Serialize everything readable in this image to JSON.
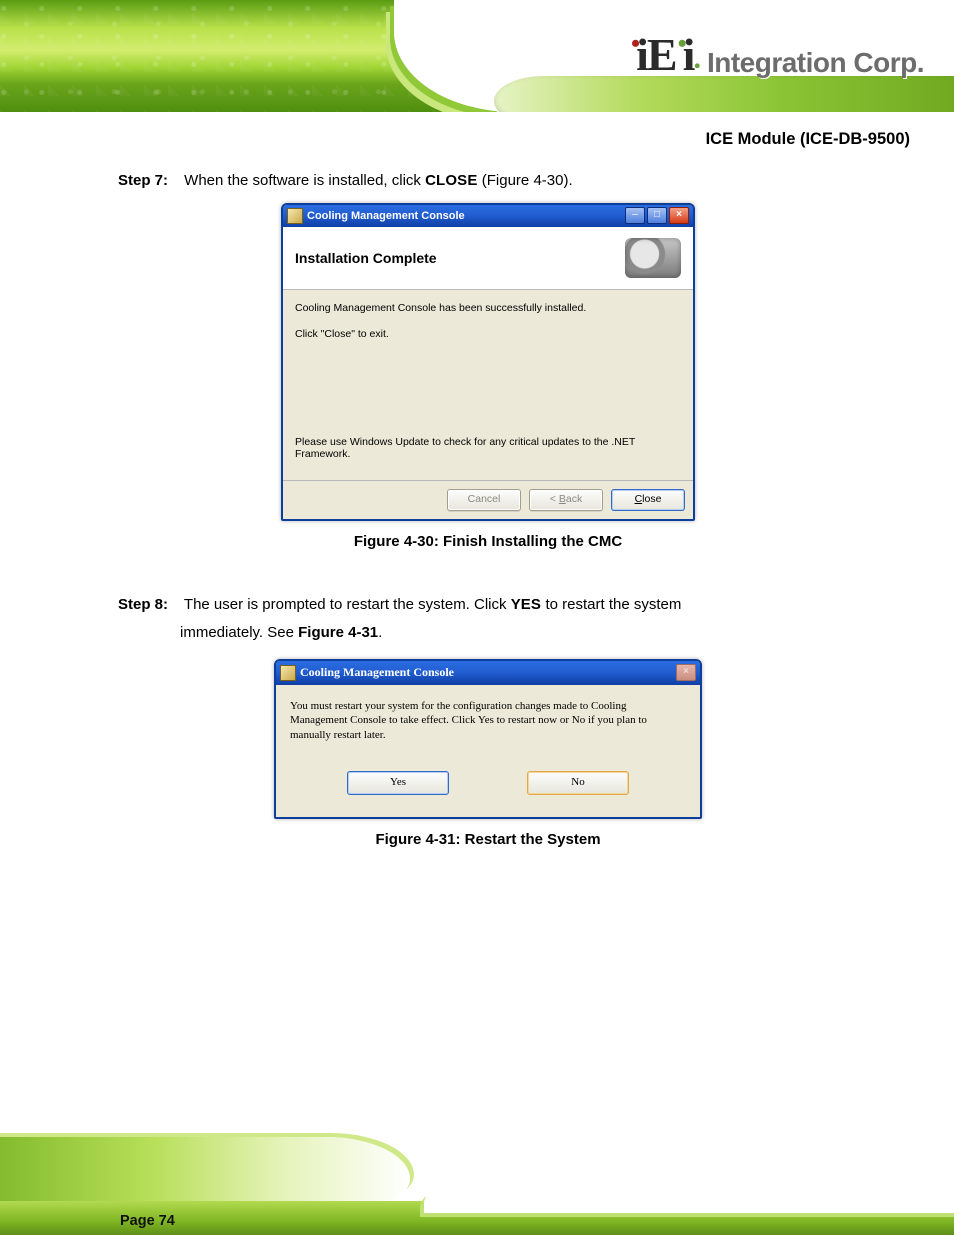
{
  "brand": {
    "logo_pre": "iE",
    "logo_post": "i",
    "tagline": "Integration Corp."
  },
  "product_title": "ICE Module (ICE-DB-9500)",
  "steps": {
    "s7": {
      "num": "Step 7:",
      "text_a": "When the software is installed, click ",
      "bold": "C",
      "smallcaps": "LOSE",
      "text_b": " (Figure 4-30)."
    },
    "s8": {
      "num": "Step 8:",
      "text_a": "The user is prompted to restart the system. Click ",
      "bold_a": "Y",
      "smallcaps_a": "ES ",
      "text_b": "to restart the system",
      "text_c": "immediately. See ",
      "bold_b": "Figure 4-31",
      "text_d": "."
    }
  },
  "captions": {
    "c1": "Figure 4-30: Finish Installing the CMC",
    "c2": "Figure 4-31: Restart the System"
  },
  "msi": {
    "title": "Cooling Management Console",
    "header": "Installation Complete",
    "line1": "Cooling Management Console has been successfully installed.",
    "line2": "Click \"Close\" to exit.",
    "note": "Please use Windows Update to check for any critical updates to the .NET Framework.",
    "btn_cancel": "Cancel",
    "btn_back_arrow": "< ",
    "btn_back": "Back",
    "btn_close": "Close"
  },
  "dlg": {
    "title": "Cooling Management Console",
    "msg": "You must restart your system for the configuration changes made to Cooling Management Console to take effect. Click Yes to restart now or No if you plan to manually restart later.",
    "yes": "Yes",
    "no": "No"
  },
  "page_label": "Page 74"
}
